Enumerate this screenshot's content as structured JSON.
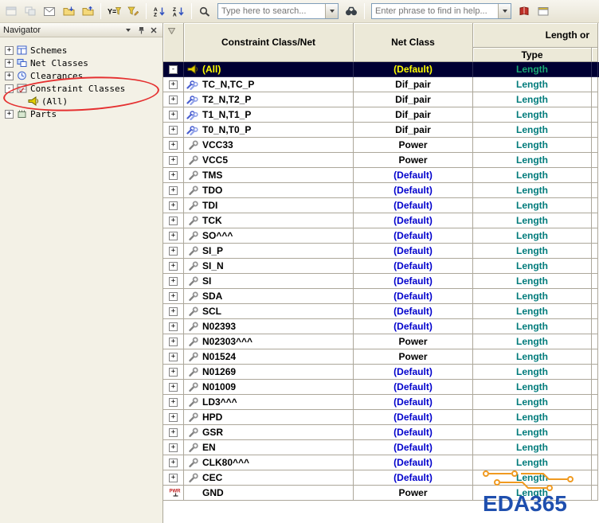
{
  "toolbar": {
    "search_placeholder": "Type here to search...",
    "help_placeholder": "Enter phrase to find in help...",
    "icons": [
      "window-icon",
      "tile-windows-icon",
      "mail-icon",
      "import-folder-icon",
      "export-folder-icon",
      "filter-y-icon",
      "filter-edit-icon",
      "sort-asc-icon",
      "sort-desc-icon",
      "search-icon",
      "binoculars-icon",
      "help-book-icon",
      "help-window-icon"
    ]
  },
  "navigator": {
    "title": "Navigator",
    "items": [
      {
        "label": "Schemes",
        "level": 0,
        "expand": "plus",
        "icon": "schemes"
      },
      {
        "label": "Net Classes",
        "level": 0,
        "expand": "plus",
        "icon": "netclasses"
      },
      {
        "label": "Clearances",
        "level": 0,
        "expand": "plus",
        "icon": "clearances"
      },
      {
        "label": "Constraint Classes",
        "level": 0,
        "expand": "minus",
        "icon": "constraintclasses"
      },
      {
        "label": "(All)",
        "level": 1,
        "expand": null,
        "icon": "bullhorn"
      },
      {
        "label": "Parts",
        "level": 0,
        "expand": "plus",
        "icon": "parts"
      }
    ]
  },
  "table": {
    "header": {
      "constraint_col": "Constraint Class/Net",
      "net_class_col": "Net Class",
      "group_col": "Length or",
      "type_col": "Type"
    },
    "rows": [
      {
        "name": "(All)",
        "net_class": "(Default)",
        "type": "Length",
        "icon": "bullhorn",
        "expand": "minus",
        "selected": true
      },
      {
        "name": "TC_N,TC_P",
        "net_class": "Dif_pair",
        "type": "Length",
        "icon": "diffpair",
        "expand": "plus"
      },
      {
        "name": "T2_N,T2_P",
        "net_class": "Dif_pair",
        "type": "Length",
        "icon": "diffpair",
        "expand": "plus"
      },
      {
        "name": "T1_N,T1_P",
        "net_class": "Dif_pair",
        "type": "Length",
        "icon": "diffpair",
        "expand": "plus"
      },
      {
        "name": "T0_N,T0_P",
        "net_class": "Dif_pair",
        "type": "Length",
        "icon": "diffpair",
        "expand": "plus"
      },
      {
        "name": "VCC33",
        "net_class": "Power",
        "type": "Length",
        "icon": "wrench",
        "expand": "plus"
      },
      {
        "name": "VCC5",
        "net_class": "Power",
        "type": "Length",
        "icon": "wrench",
        "expand": "plus"
      },
      {
        "name": "TMS",
        "net_class": "(Default)",
        "type": "Length",
        "icon": "wrench",
        "expand": "plus"
      },
      {
        "name": "TDO",
        "net_class": "(Default)",
        "type": "Length",
        "icon": "wrench",
        "expand": "plus"
      },
      {
        "name": "TDI",
        "net_class": "(Default)",
        "type": "Length",
        "icon": "wrench",
        "expand": "plus"
      },
      {
        "name": "TCK",
        "net_class": "(Default)",
        "type": "Length",
        "icon": "wrench",
        "expand": "plus"
      },
      {
        "name": "SO^^^",
        "net_class": "(Default)",
        "type": "Length",
        "icon": "wrench",
        "expand": "plus"
      },
      {
        "name": "SI_P",
        "net_class": "(Default)",
        "type": "Length",
        "icon": "wrench",
        "expand": "plus"
      },
      {
        "name": "SI_N",
        "net_class": "(Default)",
        "type": "Length",
        "icon": "wrench",
        "expand": "plus"
      },
      {
        "name": "SI",
        "net_class": "(Default)",
        "type": "Length",
        "icon": "wrench",
        "expand": "plus"
      },
      {
        "name": "SDA",
        "net_class": "(Default)",
        "type": "Length",
        "icon": "wrench",
        "expand": "plus"
      },
      {
        "name": "SCL",
        "net_class": "(Default)",
        "type": "Length",
        "icon": "wrench",
        "expand": "plus"
      },
      {
        "name": "N02393",
        "net_class": "(Default)",
        "type": "Length",
        "icon": "wrench",
        "expand": "plus"
      },
      {
        "name": "N02303^^^",
        "net_class": "Power",
        "type": "Length",
        "icon": "wrench",
        "expand": "plus"
      },
      {
        "name": "N01524",
        "net_class": "Power",
        "type": "Length",
        "icon": "wrench",
        "expand": "plus"
      },
      {
        "name": "N01269",
        "net_class": "(Default)",
        "type": "Length",
        "icon": "wrench",
        "expand": "plus"
      },
      {
        "name": "N01009",
        "net_class": "(Default)",
        "type": "Length",
        "icon": "wrench",
        "expand": "plus"
      },
      {
        "name": "LD3^^^",
        "net_class": "(Default)",
        "type": "Length",
        "icon": "wrench",
        "expand": "plus"
      },
      {
        "name": "HPD",
        "net_class": "(Default)",
        "type": "Length",
        "icon": "wrench",
        "expand": "plus"
      },
      {
        "name": "GSR",
        "net_class": "(Default)",
        "type": "Length",
        "icon": "wrench",
        "expand": "plus"
      },
      {
        "name": "EN",
        "net_class": "(Default)",
        "type": "Length",
        "icon": "wrench",
        "expand": "plus"
      },
      {
        "name": "CLK80^^^",
        "net_class": "(Default)",
        "type": "Length",
        "icon": "wrench",
        "expand": "plus"
      },
      {
        "name": "CEC",
        "net_class": "(Default)",
        "type": "Length",
        "icon": "wrench",
        "expand": "plus"
      },
      {
        "name": "GND",
        "net_class": "Power",
        "type": "Length",
        "icon": "power",
        "expand": null,
        "icon_pos": "gutter"
      }
    ]
  },
  "logo_text": "EDA365",
  "colors": {
    "selected_row_bg": "#000033",
    "selected_text": "#ffff00",
    "selected_length": "#19a974",
    "default_value_blue": "#0000cc",
    "length_teal": "#007b7b",
    "annotation_red": "#e53030",
    "logo_blue": "#1f4fae",
    "logo_orange": "#f09a20"
  }
}
